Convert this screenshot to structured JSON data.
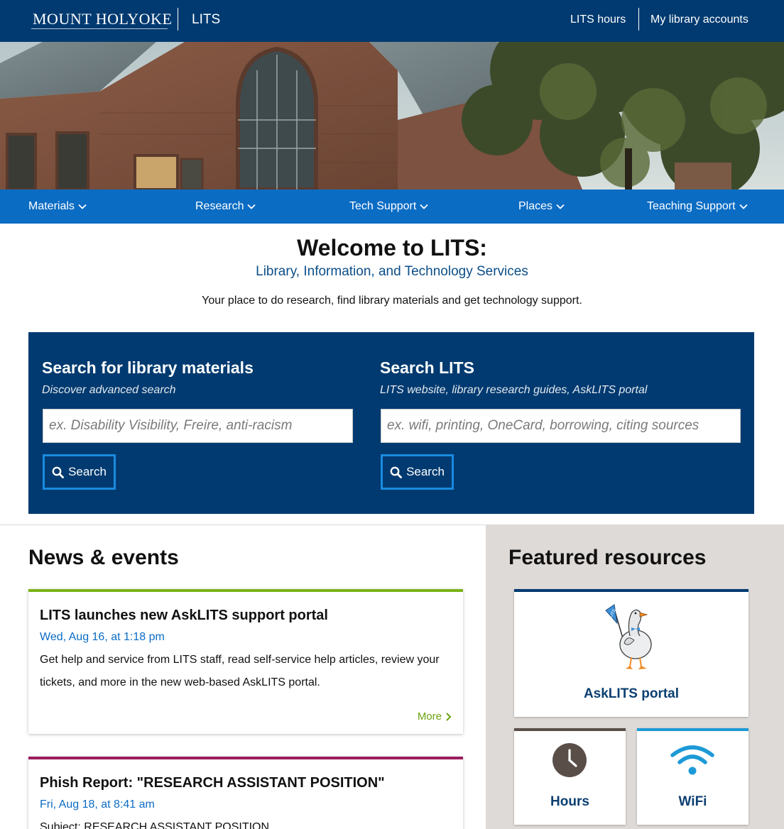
{
  "header": {
    "logo_text": "MOUNT HOLYOKE",
    "site_name": "LITS",
    "links": [
      "LITS hours",
      "My library accounts"
    ]
  },
  "nav": {
    "items": [
      "Materials",
      "Research",
      "Tech Support",
      "Places",
      "Teaching Support"
    ]
  },
  "welcome": {
    "title": "Welcome to LITS:",
    "subtitle": "Library, Information, and Technology Services",
    "description": "Your place to do research, find library materials and get technology support."
  },
  "search": {
    "library": {
      "title": "Search for library materials",
      "hint": "Discover advanced search",
      "placeholder": "ex. Disability Visibility, Freire, anti-racism",
      "button": "Search"
    },
    "lits": {
      "title": "Search LITS",
      "hint": "LITS website, library research guides, AskLITS portal",
      "placeholder": "ex. wifi, printing, OneCard, borrowing, citing sources",
      "button": "Search"
    }
  },
  "news": {
    "heading": "News & events",
    "items": [
      {
        "title": "LITS launches new AskLITS support portal",
        "date": "Wed, Aug 16, at 1:18 pm",
        "body": "Get help and service from LITS staff, read self-service help articles, review your tickets, and more in the new web-based AskLITS portal.",
        "more": "More",
        "accent": "#7ab317"
      },
      {
        "title": "Phish Report: \"RESEARCH ASSISTANT POSITION\"",
        "date": "Fri, Aug 18, at 8:41 am",
        "body": "Subject: RESEARCH ASSISTANT POSITION",
        "accent": "#9b1d5e"
      }
    ]
  },
  "featured": {
    "heading": "Featured resources",
    "items": [
      {
        "label": "AskLITS portal",
        "icon": "goose-mascot-icon",
        "accent": "#003a70"
      },
      {
        "label": "Hours",
        "icon": "clock-icon",
        "accent": "#5a4e48"
      },
      {
        "label": "WiFi",
        "icon": "wifi-icon",
        "accent": "#1d9ad6"
      }
    ],
    "mascot_flag_text": "LITS"
  },
  "colors": {
    "header_bg": "#003a70",
    "nav_bg": "#0b6cc4",
    "link_blue": "#0b6cc4",
    "more_green": "#6aa20f",
    "featured_bg": "#dedad7"
  }
}
